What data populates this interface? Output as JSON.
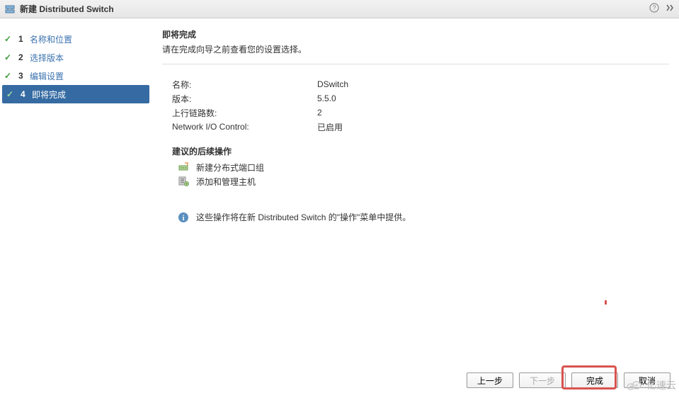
{
  "title": "新建 Distributed Switch",
  "steps": [
    {
      "num": "1",
      "label": "名称和位置",
      "done": true,
      "active": false
    },
    {
      "num": "2",
      "label": "选择版本",
      "done": true,
      "active": false
    },
    {
      "num": "3",
      "label": "编辑设置",
      "done": true,
      "active": false
    },
    {
      "num": "4",
      "label": "即将完成",
      "done": true,
      "active": true
    }
  ],
  "main": {
    "heading": "即将完成",
    "subheading": "请在完成向导之前查看您的设置选择。"
  },
  "props": {
    "name_label": "名称:",
    "name_value": "DSwitch",
    "version_label": "版本:",
    "version_value": "5.5.0",
    "uplinks_label": "上行链路数:",
    "uplinks_value": "2",
    "nioc_label": "Network I/O Control:",
    "nioc_value": "已启用"
  },
  "suggest": {
    "heading": "建议的后续操作",
    "portgroup": "新建分布式端口组",
    "hosts": "添加和管理主机",
    "info": "这些操作将在新 Distributed Switch 的\"操作\"菜单中提供。"
  },
  "buttons": {
    "back": "上一步",
    "next": "下一步",
    "finish": "完成",
    "cancel": "取消"
  },
  "watermark": "亿速云"
}
